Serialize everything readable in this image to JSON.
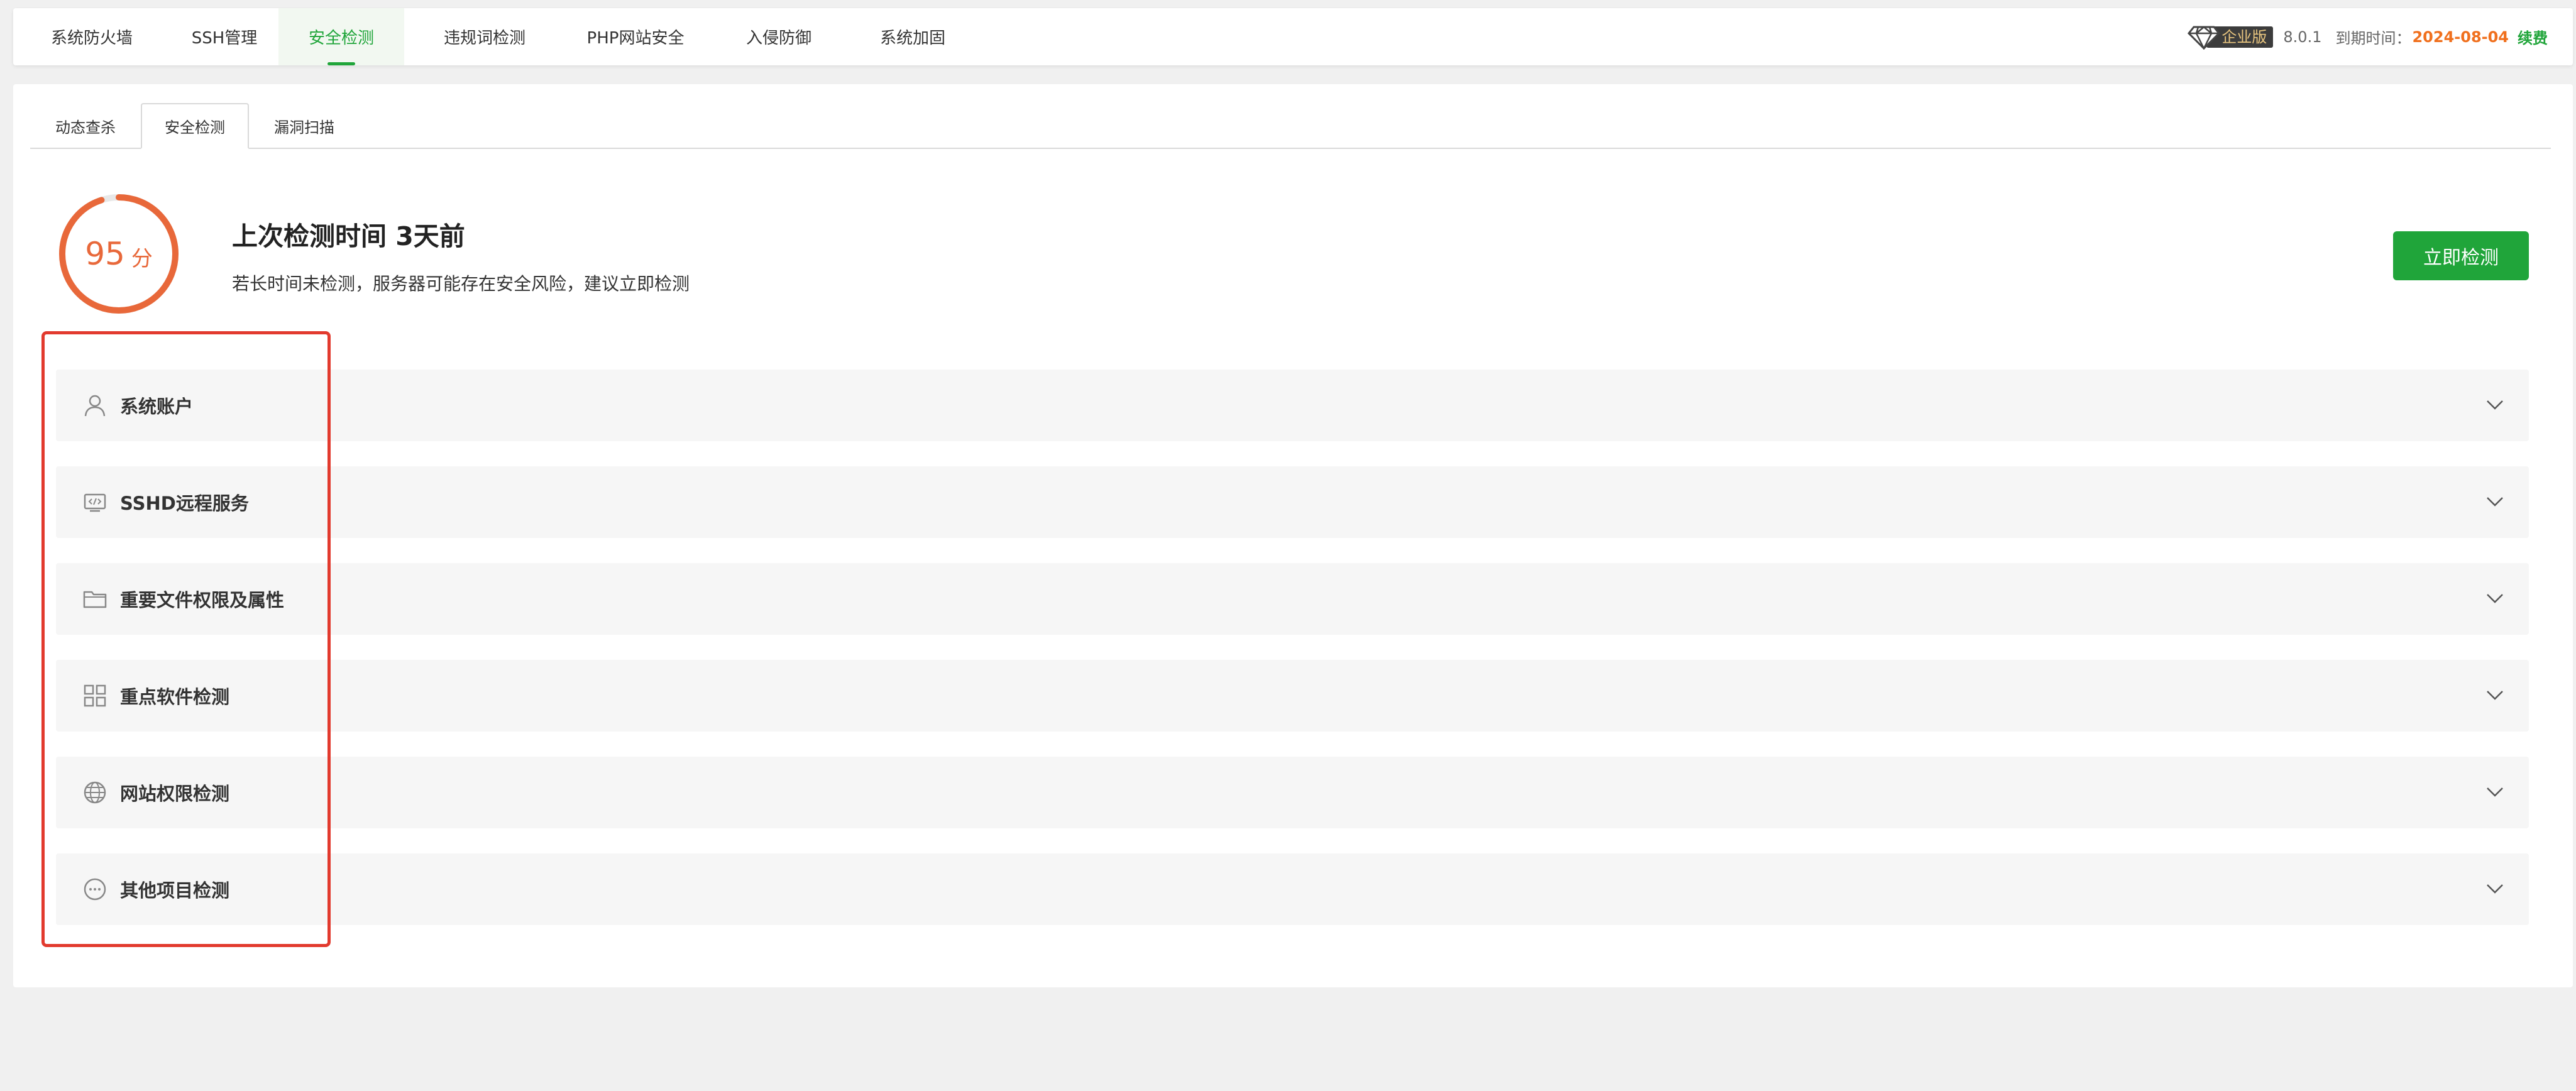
{
  "nav": {
    "tabs": [
      {
        "label": "系统防火墙"
      },
      {
        "label": "SSH管理"
      },
      {
        "label": "安全检测"
      },
      {
        "label": "违规词检测"
      },
      {
        "label": "PHP网站安全"
      },
      {
        "label": "入侵防御"
      },
      {
        "label": "系统加固"
      }
    ],
    "active_tab": "安全检测",
    "edition": "企业版",
    "version": "8.0.1",
    "expire_label": "到期时间：",
    "expire_date": "2024-08-04",
    "renew": "续费"
  },
  "subtabs": [
    {
      "label": "动态查杀"
    },
    {
      "label": "安全检测"
    },
    {
      "label": "漏洞扫描"
    }
  ],
  "score": {
    "value": "95",
    "unit": "分",
    "title": "上次检测时间 3天前",
    "desc": "若长时间未检测，服务器可能存在安全风险，建议立即检测",
    "button": "立即检测"
  },
  "items": [
    {
      "label": "系统账户",
      "icon": "user-icon"
    },
    {
      "label": "SSHD远程服务",
      "icon": "terminal-icon"
    },
    {
      "label": "重要文件权限及属性",
      "icon": "folder-icon"
    },
    {
      "label": "重点软件检测",
      "icon": "grid-icon"
    },
    {
      "label": "网站权限检测",
      "icon": "globe-icon"
    },
    {
      "label": "其他项目检测",
      "icon": "more-icon"
    }
  ],
  "colors": {
    "accent": "#20a53a",
    "score": "#e8683a",
    "highlight": "#e23a2e",
    "expire": "#f0701e"
  }
}
